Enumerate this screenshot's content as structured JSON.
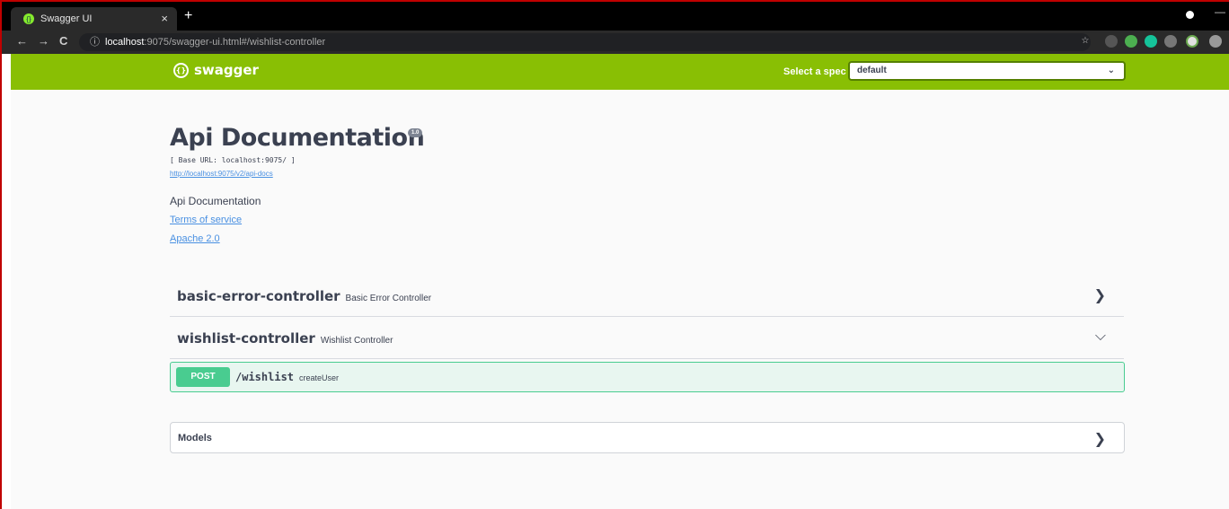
{
  "browser": {
    "tab_title": "Swagger UI",
    "tab_close": "×",
    "new_tab": "+",
    "url_host": "localhost",
    "url_rest": ":9075/swagger-ui.html#/wishlist-controller"
  },
  "topbar": {
    "logo_text": "swagger",
    "spec_label": "Select a spec",
    "spec_selected": "default"
  },
  "info": {
    "title": "Api Documentation",
    "version": "1.0",
    "base_url": "[ Base URL: localhost:9075/ ]",
    "docs_link": "http://localhost:9075/v2/api-docs",
    "description": "Api Documentation",
    "terms_of_service": "Terms of service",
    "license": "Apache 2.0"
  },
  "tags": [
    {
      "name": "basic-error-controller",
      "description": "Basic Error Controller",
      "expanded": false
    },
    {
      "name": "wishlist-controller",
      "description": "Wishlist Controller",
      "expanded": true
    }
  ],
  "operations": [
    {
      "method": "POST",
      "path": "/wishlist",
      "summary": "createUser"
    }
  ],
  "models": {
    "label": "Models"
  },
  "colors": {
    "topbar": "#89bf04",
    "post": "#49cc90",
    "post_bg": "#e8f6f0",
    "text": "#3b4151",
    "link": "#4990e2"
  }
}
